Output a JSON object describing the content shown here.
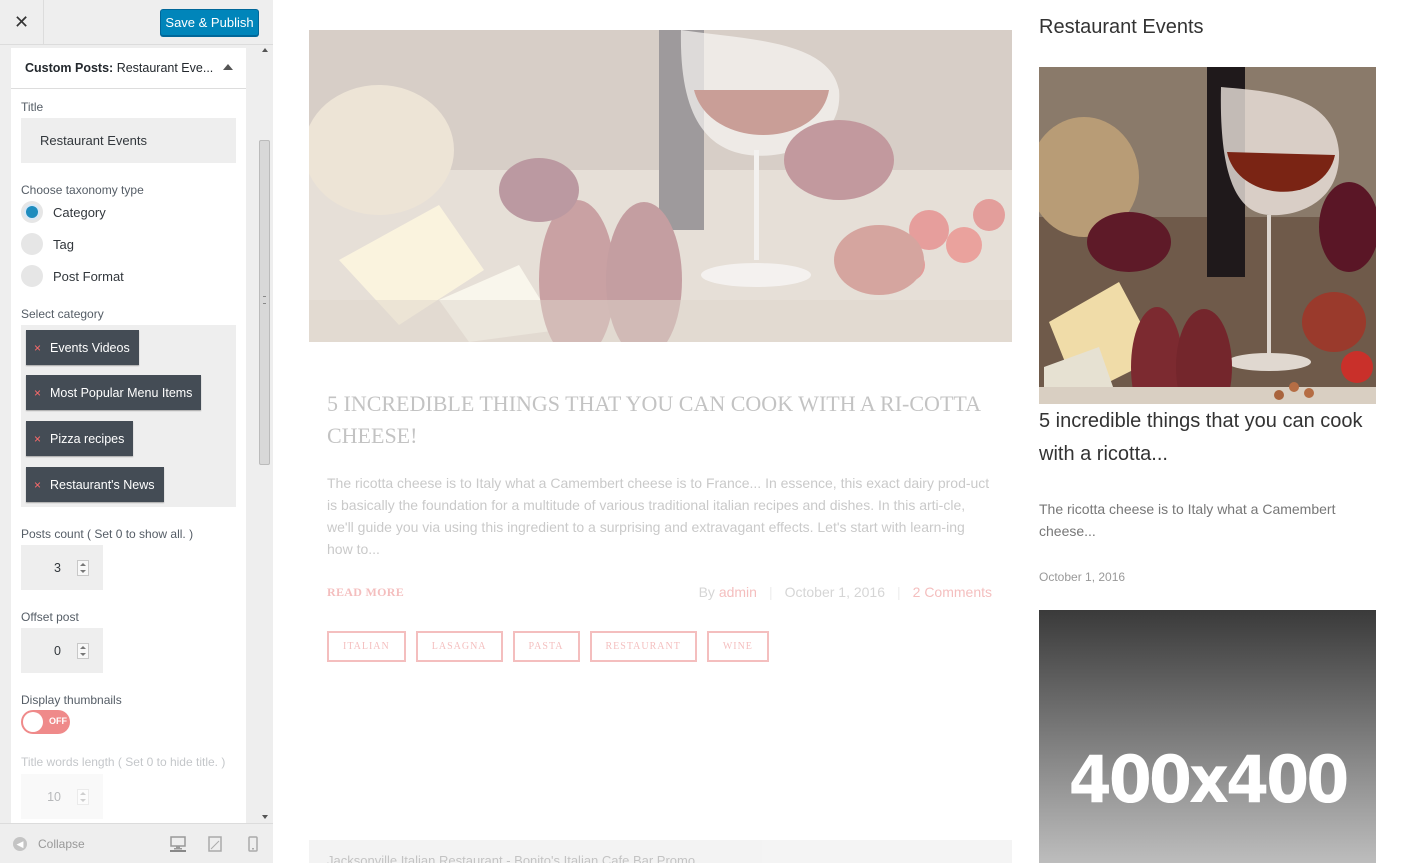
{
  "topbar": {
    "close_glyph": "✕",
    "publish_label": "Save & Publish"
  },
  "panel": {
    "header_prefix": "Custom Posts:",
    "header_title": "Restaurant Eve...",
    "title_label": "Title",
    "title_value": "Restaurant Events",
    "taxonomy_label": "Choose taxonomy type",
    "taxonomy_options": [
      {
        "label": "Category",
        "checked": true
      },
      {
        "label": "Tag",
        "checked": false
      },
      {
        "label": "Post Format",
        "checked": false
      }
    ],
    "category_label": "Select category",
    "categories": [
      "Events Videos",
      "Most Popular Menu Items",
      "Pizza recipes",
      "Restaurant's News"
    ],
    "remove_glyph": "×",
    "posts_count_label": "Posts count ( Set 0 to show all. )",
    "posts_count_value": "3",
    "offset_label": "Offset post",
    "offset_value": "0",
    "thumbnails_label": "Display thumbnails",
    "thumbnails_toggle": "OFF",
    "title_words_label": "Title words length ( Set 0 to hide title. )",
    "title_words_value": "10"
  },
  "footer": {
    "collapse_label": "Collapse",
    "collapse_icon": "◀"
  },
  "preview": {
    "post_title": "5 INCREDIBLE THINGS THAT YOU CAN COOK WITH A RI-COTTA CHEESE!",
    "post_excerpt": "The ricotta cheese is to Italy what a Camembert cheese is to France... In essence, this exact dairy prod-uct is basically the foundation for a multitude of various traditional italian recipes and dishes. In this arti-cle, we'll guide you via using this ingredient to a surprising and extravagant effects. Let's start with learn-ing how to...",
    "read_more": "READ MORE",
    "by_label": "By",
    "author": "admin",
    "date": "October 1, 2016",
    "comments": "2 Comments",
    "tags": [
      "ITALIAN",
      "LASAGNA",
      "PASTA",
      "RESTAURANT",
      "WINE"
    ],
    "bottom_bar_text": "Jacksonville Italian Restaurant - Bonito's Italian Cafe Bar Promo"
  },
  "widget": {
    "title": "Restaurant Events",
    "post_title": "5 incredible things that you can cook with a ricotta...",
    "excerpt": "The ricotta cheese is to Italy what a Camembert cheese...",
    "date": "October 1, 2016",
    "placeholder_text": "400x400"
  },
  "colors": {
    "accent_blue": "#0085ba",
    "chip_bg": "#444c55",
    "toggle_off": "#ef8a8a",
    "link_red": "#e04848"
  }
}
